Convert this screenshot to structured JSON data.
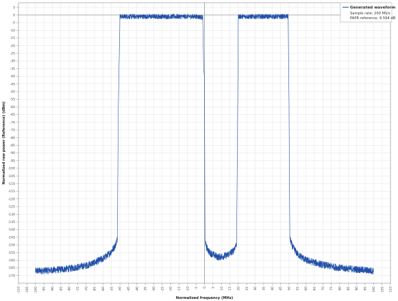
{
  "chart_data": {
    "type": "line",
    "xlabel": "Normalized frequency (MHz)",
    "ylabel": "Normalized raw power (Reference) (dBm)",
    "xlim": [
      -110,
      110
    ],
    "ylim": [
      -175,
      8
    ],
    "x_ticks": [
      -110,
      -105,
      -100,
      -95,
      -90,
      -85,
      -80,
      -75,
      -70,
      -65,
      -60,
      -55,
      -50,
      -45,
      -40,
      -35,
      -30,
      -25,
      -20,
      -15,
      -10,
      -5,
      0,
      5,
      10,
      15,
      20,
      25,
      30,
      35,
      40,
      45,
      50,
      55,
      60,
      65,
      70,
      75,
      80,
      85,
      90,
      95,
      100,
      105,
      110
    ],
    "y_ticks": [
      5,
      0,
      -5,
      -10,
      -15,
      -20,
      -25,
      -30,
      -35,
      -40,
      -45,
      -50,
      -55,
      -60,
      -65,
      -70,
      -75,
      -80,
      -85,
      -90,
      -95,
      -100,
      -105,
      -110,
      -115,
      -120,
      -125,
      -130,
      -135,
      -140,
      -145,
      -150,
      -155,
      -160,
      -165,
      -170
    ],
    "grid": true,
    "legend_position": "top-right",
    "series": [
      {
        "name": "Generated waveform",
        "color": "#1f4fa8",
        "x": [
          -100,
          -90,
          -80,
          -70,
          -65,
          -60,
          -56,
          -53,
          -51.5,
          -51,
          -50,
          -30,
          -5,
          -1,
          -0.5,
          0,
          0.3,
          1,
          3,
          8,
          13,
          17,
          19,
          19.6,
          20,
          30,
          49.5,
          50,
          50.5,
          52,
          55,
          60,
          70,
          80,
          90,
          100
        ],
        "y": [
          -167,
          -166.5,
          -165.5,
          -163.5,
          -161.5,
          -159,
          -155.5,
          -151,
          -146,
          -62,
          -1,
          -1,
          -1,
          -1.5,
          -35,
          -40,
          -146,
          -151,
          -155,
          -158,
          -157,
          -154,
          -149,
          -68,
          -1,
          -1,
          -1,
          -57,
          -146,
          -151,
          -156,
          -160,
          -163,
          -165,
          -166,
          -167
        ]
      }
    ],
    "annotations": [
      "Sample rate: 200 MS/s",
      "PAPR reference: 9.594 dB"
    ]
  }
}
